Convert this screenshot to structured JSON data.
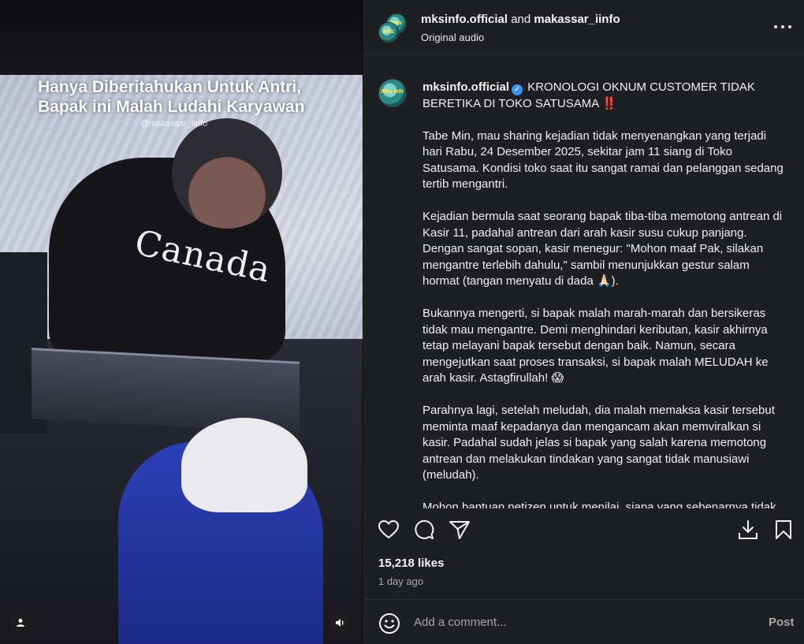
{
  "media": {
    "caption": "Hanya Diberitahukan Untuk Antri, Bapak ini Malah Ludahi Karyawan",
    "watermark": "@makassar_iinfo",
    "shirt_text": "Canada",
    "icons": [
      "user-icon",
      "speaker-icon"
    ]
  },
  "header": {
    "user1": "mksinfo.official",
    "connector": "and",
    "user2": "makassar_iinfo",
    "audio": "Original audio",
    "more_icon": "more-horizontal-icon"
  },
  "post": {
    "username": "mksinfo.official",
    "headline": "KRONOLOGI OKNUM CUSTOMER TIDAK BERETIKA DI TOKO SATUSAMA",
    "headline_emoji": "‼️",
    "paragraphs": [
      "Tabe Min, mau sharing kejadian tidak menyenangkan yang terjadi hari Rabu, 24 Desember 2025, sekitar jam 11 siang di Toko Satusama. Kondisi toko saat itu sangat ramai dan pelanggan sedang tertib mengantri.",
      "Kejadian bermula saat seorang bapak tiba-tiba memotong antrean di Kasir 11, padahal antrean dari arah kasir susu cukup panjang. Dengan sangat sopan, kasir menegur: \"Mohon maaf Pak, silakan mengantre terlebih dahulu,\" sambil menunjukkan gestur salam hormat (tangan menyatu di dada 🙏🏻).",
      "Bukannya mengerti, si bapak malah marah-marah dan bersikeras tidak mau mengantre. Demi menghindari keributan, kasir akhirnya tetap melayani bapak tersebut dengan baik. Namun, secara mengejutkan saat proses transaksi, si bapak malah MELUDAH ke arah kasir. Astagfirullah! 😱",
      "Parahnya lagi, setelah meludah, dia malah memaksa kasir tersebut meminta maaf kepadanya dan mengancam akan memviralkan si kasir. Padahal sudah jelas si bapak yang salah karena memotong antrean dan melakukan tindakan yang sangat tidak manusiawi (meludah).",
      "Mohon bantuan netizen untuk menilai, siapa yang sebenarnya tidak"
    ]
  },
  "actions": {
    "icons": [
      "heart-icon",
      "comment-icon",
      "share-icon",
      "download-icon",
      "bookmark-icon"
    ],
    "likes": "15,218 likes",
    "time": "1 day ago"
  },
  "comment": {
    "placeholder": "Add a comment...",
    "post_label": "Post",
    "emoji_icon": "emoji-icon"
  },
  "colors": {
    "panel_bg": "#1e1f22",
    "verified": "#3797f0",
    "muted_text": "#a8a8a8",
    "cashier_uniform": "#2d3fb7"
  }
}
